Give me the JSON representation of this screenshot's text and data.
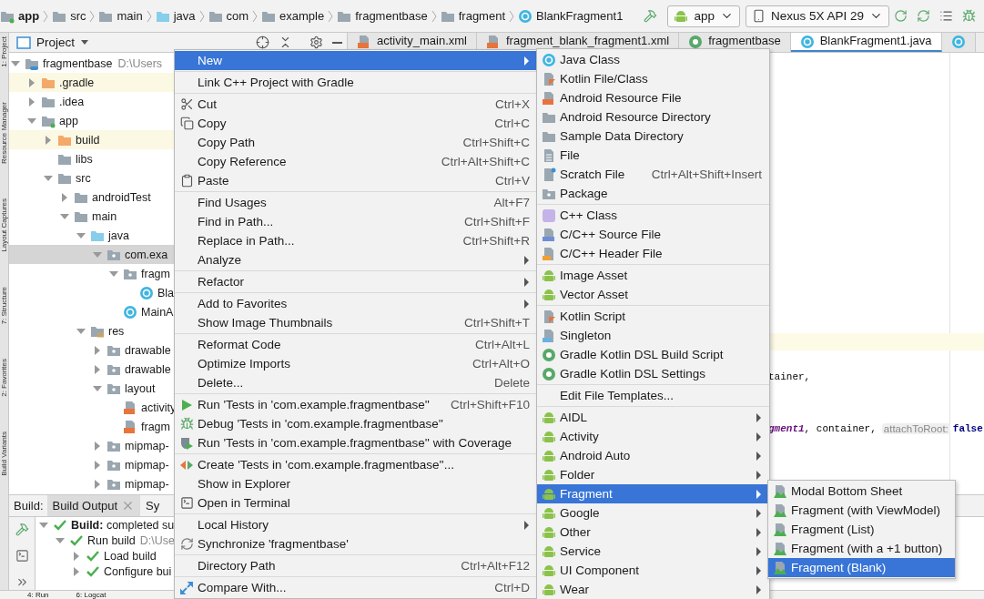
{
  "breadcrumbs": [
    {
      "label": "app",
      "kind": "module"
    },
    {
      "label": "src",
      "kind": "folder"
    },
    {
      "label": "main",
      "kind": "folder"
    },
    {
      "label": "java",
      "kind": "source"
    },
    {
      "label": "com",
      "kind": "folder"
    },
    {
      "label": "example",
      "kind": "folder"
    },
    {
      "label": "fragmentbase",
      "kind": "folder"
    },
    {
      "label": "fragment",
      "kind": "folder"
    },
    {
      "label": "BlankFragment1",
      "kind": "class"
    }
  ],
  "toolbar": {
    "run_config": "app",
    "device": "Nexus 5X API 29"
  },
  "side_strip": [
    "1: Project",
    "Resource Manager",
    "Layout Captures",
    "7: Structure",
    "2: Favorites",
    "Build Variants"
  ],
  "project_panel": {
    "title": "Project",
    "tree": [
      {
        "label": "fragmentbase",
        "detail": "D:\\Users",
        "kind": "project",
        "expanded": true,
        "selected": false,
        "children": [
          {
            "label": ".gradle",
            "kind": "excluded",
            "expanded": false,
            "selected": false
          },
          {
            "label": ".idea",
            "kind": "folder",
            "expanded": false,
            "selected": false
          },
          {
            "label": "app",
            "kind": "module",
            "expanded": true,
            "selected": false,
            "children": [
              {
                "label": "build",
                "kind": "excluded",
                "expanded": false,
                "selected": false
              },
              {
                "label": "libs",
                "kind": "folder",
                "selected": false
              },
              {
                "label": "src",
                "kind": "folder",
                "expanded": true,
                "selected": false,
                "children": [
                  {
                    "label": "androidTest",
                    "kind": "folder",
                    "expanded": false,
                    "selected": false
                  },
                  {
                    "label": "main",
                    "kind": "folder",
                    "expanded": true,
                    "selected": false,
                    "children": [
                      {
                        "label": "java",
                        "kind": "source",
                        "expanded": true,
                        "selected": false,
                        "children": [
                          {
                            "label": "com.exa",
                            "kind": "package",
                            "expanded": true,
                            "selected": true,
                            "children": [
                              {
                                "label": "fragm",
                                "kind": "package",
                                "expanded": true,
                                "selected": false,
                                "children": [
                                  {
                                    "label": "Bla",
                                    "kind": "class",
                                    "selected": false
                                  }
                                ]
                              },
                              {
                                "label": "MainA",
                                "kind": "class",
                                "selected": false
                              }
                            ]
                          }
                        ]
                      },
                      {
                        "label": "res",
                        "kind": "res",
                        "expanded": true,
                        "selected": false,
                        "children": [
                          {
                            "label": "drawable",
                            "kind": "package",
                            "expanded": false,
                            "selected": false
                          },
                          {
                            "label": "drawable",
                            "kind": "package",
                            "expanded": false,
                            "selected": false
                          },
                          {
                            "label": "layout",
                            "kind": "package",
                            "expanded": true,
                            "selected": false,
                            "children": [
                              {
                                "label": "activity",
                                "kind": "xml",
                                "selected": false
                              },
                              {
                                "label": "fragm",
                                "kind": "xml",
                                "selected": false
                              }
                            ]
                          },
                          {
                            "label": "mipmap-",
                            "kind": "package",
                            "expanded": false,
                            "selected": false
                          },
                          {
                            "label": "mipmap-",
                            "kind": "package",
                            "expanded": false,
                            "selected": false
                          },
                          {
                            "label": "mipmap-",
                            "kind": "package",
                            "expanded": false,
                            "selected": false
                          }
                        ]
                      }
                    ]
                  }
                ]
              }
            ]
          }
        ]
      }
    ]
  },
  "editor": {
    "tabs": [
      {
        "label": "activity_main.xml",
        "kind": "xml",
        "selected": false
      },
      {
        "label": "fragment_blank_fragment1.xml",
        "kind": "xml",
        "selected": false
      },
      {
        "label": "fragmentbase",
        "kind": "gradle",
        "selected": false
      },
      {
        "label": "BlankFragment1.java",
        "kind": "class",
        "selected": true
      }
    ],
    "lines": [
      {
        "kind": "blank"
      },
      {
        "kind": "blank"
      },
      {
        "kind": "blank"
      },
      {
        "kind": "blank"
      },
      {
        "kind": "blank"
      },
      {
        "kind": "blank"
      },
      {
        "kind": "blank"
      },
      {
        "kind": "blank"
      },
      {
        "kind": "blank"
      },
      {
        "kind": "blank"
      },
      {
        "kind": "blank"
      },
      {
        "kind": "blank"
      },
      {
        "kind": "blank"
      },
      {
        "kind": "blank"
      },
      {
        "kind": "blank"
      },
      {
        "kind": "blank"
      },
      {
        "kind": "current"
      },
      {
        "kind": "blank"
      },
      {
        "kind": "code",
        "tokens": [
          {
            "kind": "plain",
            "text": "tainer,"
          }
        ]
      },
      {
        "kind": "blank"
      },
      {
        "kind": "blank"
      },
      {
        "kind": "code",
        "tokens": [
          {
            "kind": "field",
            "text": "gment1"
          },
          {
            "kind": "plain",
            "text": ", container,"
          },
          {
            "kind": "hint",
            "text": "attachToRoot:"
          },
          {
            "kind": "keyword",
            "text": "false"
          }
        ]
      }
    ]
  },
  "build_panel": {
    "label": "Build:",
    "tabs": [
      {
        "label": "Build Output",
        "selected": true
      },
      {
        "label": "Sy",
        "selected": false
      }
    ],
    "tree": [
      {
        "label": "**Build:** completed su",
        "expanded": true,
        "children": [
          {
            "label": "Run build",
            "detail": "D:\\Use",
            "expanded": true,
            "children": [
              {
                "label": "Load build",
                "expanded": false
              },
              {
                "label": "Configure bui",
                "expanded": false
              }
            ]
          }
        ]
      }
    ]
  },
  "bottom_bar": [
    "4: Run",
    "6: Logcat"
  ],
  "context_menu": [
    [
      {
        "label": "New",
        "kind": "plain",
        "submenu": true,
        "selected": true
      }
    ],
    [
      {
        "label": "Link C++ Project with Gradle",
        "kind": "plain",
        "submenu": false,
        "selected": false
      }
    ],
    [
      {
        "label": "Cut",
        "kind": "scissors",
        "shortcut": "Ctrl+X",
        "submenu": false,
        "selected": false
      },
      {
        "label": "Copy",
        "kind": "copy",
        "shortcut": "Ctrl+C",
        "submenu": false,
        "selected": false
      },
      {
        "label": "Copy Path",
        "kind": "plain",
        "shortcut": "Ctrl+Shift+C",
        "submenu": false,
        "selected": false
      },
      {
        "label": "Copy Reference",
        "kind": "plain",
        "shortcut": "Ctrl+Alt+Shift+C",
        "submenu": false,
        "selected": false
      },
      {
        "label": "Paste",
        "kind": "paste",
        "shortcut": "Ctrl+V",
        "submenu": false,
        "selected": false
      }
    ],
    [
      {
        "label": "Find Usages",
        "kind": "plain",
        "shortcut": "Alt+F7",
        "submenu": false,
        "selected": false
      },
      {
        "label": "Find in Path...",
        "kind": "plain",
        "shortcut": "Ctrl+Shift+F",
        "submenu": false,
        "selected": false
      },
      {
        "label": "Replace in Path...",
        "kind": "plain",
        "shortcut": "Ctrl+Shift+R",
        "submenu": false,
        "selected": false
      },
      {
        "label": "Analyze",
        "kind": "plain",
        "submenu": true,
        "selected": false
      }
    ],
    [
      {
        "label": "Refactor",
        "kind": "plain",
        "submenu": true,
        "selected": false
      }
    ],
    [
      {
        "label": "Add to Favorites",
        "kind": "plain",
        "submenu": true,
        "selected": false
      },
      {
        "label": "Show Image Thumbnails",
        "kind": "plain",
        "shortcut": "Ctrl+Shift+T",
        "submenu": false,
        "selected": false
      }
    ],
    [
      {
        "label": "Reformat Code",
        "kind": "plain",
        "shortcut": "Ctrl+Alt+L",
        "submenu": false,
        "selected": false
      },
      {
        "label": "Optimize Imports",
        "kind": "plain",
        "shortcut": "Ctrl+Alt+O",
        "submenu": false,
        "selected": false
      },
      {
        "label": "Delete...",
        "kind": "plain",
        "shortcut": "Delete",
        "submenu": false,
        "selected": false
      }
    ],
    [
      {
        "label": "Run 'Tests in 'com.example.fragmentbase''",
        "kind": "run",
        "shortcut": "Ctrl+Shift+F10",
        "submenu": false,
        "selected": false
      },
      {
        "label": "Debug 'Tests in 'com.example.fragmentbase''",
        "kind": "debug",
        "submenu": false,
        "selected": false
      },
      {
        "label": "Run 'Tests in 'com.example.fragmentbase'' with Coverage",
        "kind": "coverage",
        "submenu": false,
        "selected": false
      }
    ],
    [
      {
        "label": "Create 'Tests in 'com.example.fragmentbase''...",
        "kind": "create",
        "submenu": false,
        "selected": false
      },
      {
        "label": "Show in Explorer",
        "kind": "plain",
        "submenu": false,
        "selected": false
      },
      {
        "label": "Open in Terminal",
        "kind": "terminal",
        "submenu": false,
        "selected": false
      }
    ],
    [
      {
        "label": "Local History",
        "kind": "plain",
        "submenu": true,
        "selected": false
      },
      {
        "label": "Synchronize 'fragmentbase'",
        "kind": "sync",
        "submenu": false,
        "selected": false
      }
    ],
    [
      {
        "label": "Directory Path",
        "kind": "plain",
        "shortcut": "Ctrl+Alt+F12",
        "submenu": false,
        "selected": false
      }
    ],
    [
      {
        "label": "Compare With...",
        "kind": "compare",
        "shortcut": "Ctrl+D",
        "submenu": false,
        "selected": false
      }
    ]
  ],
  "new_menu": [
    [
      {
        "label": "Java Class",
        "kind": "class",
        "submenu": false,
        "selected": false
      },
      {
        "label": "Kotlin File/Class",
        "kind": "kotlin",
        "submenu": false,
        "selected": false
      },
      {
        "label": "Android Resource File",
        "kind": "xml",
        "submenu": false,
        "selected": false
      },
      {
        "label": "Android Resource Directory",
        "kind": "folder",
        "submenu": false,
        "selected": false
      },
      {
        "label": "Sample Data Directory",
        "kind": "folder",
        "submenu": false,
        "selected": false
      },
      {
        "label": "File",
        "kind": "file",
        "submenu": false,
        "selected": false
      },
      {
        "label": "Scratch File",
        "kind": "scratch",
        "shortcut": "Ctrl+Alt+Shift+Insert",
        "submenu": false,
        "selected": false
      },
      {
        "label": "Package",
        "kind": "package",
        "submenu": false,
        "selected": false
      }
    ],
    [
      {
        "label": "C++ Class",
        "kind": "cpp-class",
        "submenu": false,
        "selected": false
      },
      {
        "label": "C/C++ Source File",
        "kind": "cpp-source",
        "submenu": false,
        "selected": false
      },
      {
        "label": "C/C++ Header File",
        "kind": "cpp-header",
        "submenu": false,
        "selected": false
      }
    ],
    [
      {
        "label": "Image Asset",
        "kind": "android",
        "submenu": false,
        "selected": false
      },
      {
        "label": "Vector Asset",
        "kind": "android",
        "submenu": false,
        "selected": false
      }
    ],
    [
      {
        "label": "Kotlin Script",
        "kind": "kotlin",
        "submenu": false,
        "selected": false
      },
      {
        "label": "Singleton",
        "kind": "singleton",
        "submenu": false,
        "selected": false
      },
      {
        "label": "Gradle Kotlin DSL Build Script",
        "kind": "gradle",
        "submenu": false,
        "selected": false
      },
      {
        "label": "Gradle Kotlin DSL Settings",
        "kind": "gradle",
        "submenu": false,
        "selected": false
      }
    ],
    [
      {
        "label": "Edit File Templates...",
        "kind": "plain",
        "submenu": false,
        "selected": false
      }
    ],
    [
      {
        "label": "AIDL",
        "kind": "android",
        "submenu": true,
        "selected": false
      },
      {
        "label": "Activity",
        "kind": "android",
        "submenu": true,
        "selected": false
      },
      {
        "label": "Android Auto",
        "kind": "android",
        "submenu": true,
        "selected": false
      },
      {
        "label": "Folder",
        "kind": "android",
        "submenu": true,
        "selected": false
      },
      {
        "label": "Fragment",
        "kind": "android",
        "submenu": true,
        "selected": true
      },
      {
        "label": "Google",
        "kind": "android",
        "submenu": true,
        "selected": false
      },
      {
        "label": "Other",
        "kind": "android",
        "submenu": true,
        "selected": false
      },
      {
        "label": "Service",
        "kind": "android",
        "submenu": true,
        "selected": false
      },
      {
        "label": "UI Component",
        "kind": "android",
        "submenu": true,
        "selected": false
      },
      {
        "label": "Wear",
        "kind": "android",
        "submenu": true,
        "selected": false
      }
    ]
  ],
  "fragment_menu": [
    [
      {
        "label": "Modal Bottom Sheet",
        "kind": "fragment",
        "submenu": false,
        "selected": false
      },
      {
        "label": "Fragment (with ViewModel)",
        "kind": "fragment",
        "submenu": false,
        "selected": false
      },
      {
        "label": "Fragment (List)",
        "kind": "fragment",
        "submenu": false,
        "selected": false
      },
      {
        "label": "Fragment (with a +1 button)",
        "kind": "fragment",
        "submenu": false,
        "selected": false
      },
      {
        "label": "Fragment (Blank)",
        "kind": "fragment",
        "submenu": false,
        "selected": true
      }
    ]
  ]
}
